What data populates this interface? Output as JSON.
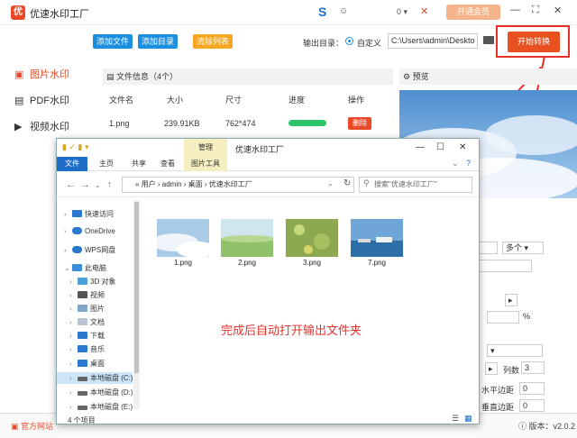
{
  "app": {
    "name": "优速水印工厂",
    "message_count": "0",
    "vip_label": "开通会员"
  },
  "sidebar": {
    "items": [
      {
        "label": "图片水印"
      },
      {
        "label": "PDF水印"
      },
      {
        "label": "视频水印"
      }
    ]
  },
  "toolbar": {
    "add_file": "添加文件",
    "add_dir": "添加目录",
    "clear_list": "清除列表",
    "output_dir_label": "输出目录：",
    "custom_label": "自定义",
    "output_path": "C:\\Users\\admin\\Deskto",
    "start_button": "开始转换"
  },
  "file_panel": {
    "title": "文件信息（4个）",
    "columns": [
      "文件名",
      "大小",
      "尺寸",
      "进度",
      "操作"
    ],
    "rows": [
      {
        "name": "1.png",
        "size": "239.91KB",
        "dims": "762*474",
        "progress": 1.0,
        "action": "删除"
      }
    ]
  },
  "preview": {
    "title": "预览"
  },
  "right_panel": {
    "dropdown_value": "多个",
    "percent_sign": "%",
    "cols_label": "列数",
    "cols_value": "3",
    "hmargin_label": "水平边距",
    "hmargin_value": "0",
    "vmargin_label": "垂直边距",
    "vmargin_value": "0"
  },
  "bottom": {
    "official_site": "官方网站",
    "version": "版本：v2.0.2"
  },
  "explorer": {
    "manage_tab": "管理",
    "window_title": "优速水印工厂",
    "ribbon_tabs": [
      "文件",
      "主页",
      "共享",
      "查看",
      "图片工具"
    ],
    "breadcrumb": "«  用户  ›  admin  ›  桌面  ›  优速水印工厂",
    "search_placeholder": "搜索\"优速水印工厂\"",
    "nav_items": [
      {
        "label": "快速访问"
      },
      {
        "label": "OneDrive"
      },
      {
        "label": "WPS网盘"
      },
      {
        "label": "此电脑"
      },
      {
        "label": "3D 对象"
      },
      {
        "label": "视频"
      },
      {
        "label": "图片"
      },
      {
        "label": "文档"
      },
      {
        "label": "下载"
      },
      {
        "label": "音乐"
      },
      {
        "label": "桌面"
      },
      {
        "label": "本地磁盘 (C:)"
      },
      {
        "label": "本地磁盘 (D:)"
      },
      {
        "label": "本地磁盘 (E:)"
      }
    ],
    "files": [
      {
        "name": "1.png"
      },
      {
        "name": "2.png"
      },
      {
        "name": "3.png"
      },
      {
        "name": "7.png"
      }
    ],
    "annotation": "完成后自动打开输出文件夹",
    "status": "4 个项目"
  },
  "colors": {
    "accent": "#e94b2a",
    "start_button": "#e8501f",
    "blue_button": "#1d8fe1",
    "orange_button": "#f5a623",
    "progress": "#2ec46a",
    "annotation": "#e8302b"
  }
}
